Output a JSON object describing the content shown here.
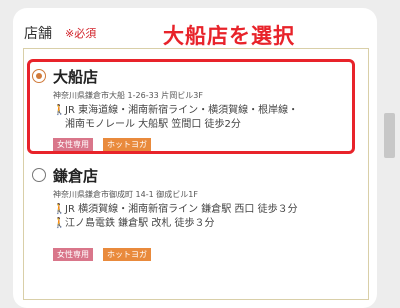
{
  "section": {
    "label": "店舗",
    "required": "※必須"
  },
  "annotation": "大船店を選択",
  "stores": [
    {
      "name": "大船店",
      "selected": true,
      "address": "神奈川県鎌倉市大船 1-26-33 片岡ビル3F",
      "access": [
        "JR 東海道線・湘南新宿ライン・横須賀線・根岸線・",
        "湘南モノレール 大船駅 笠間口 徒歩2分"
      ],
      "tags": [
        "女性専用",
        "ホットヨガ"
      ]
    },
    {
      "name": "鎌倉店",
      "selected": false,
      "address": "神奈川県鎌倉市御成町 14-1 御成ビル1F",
      "access": [
        "JR 横須賀線・湘南新宿ライン 鎌倉駅 西口 徒歩３分",
        "江ノ島電鉄 鎌倉駅 改札 徒歩３分"
      ],
      "tags": [
        "女性専用",
        "ホットヨガ"
      ]
    }
  ],
  "colors": {
    "accent_red": "#e8232a",
    "radio_selected": "#d07a3a",
    "tag_pink": "#d9768a",
    "tag_orange": "#e98a3c"
  }
}
